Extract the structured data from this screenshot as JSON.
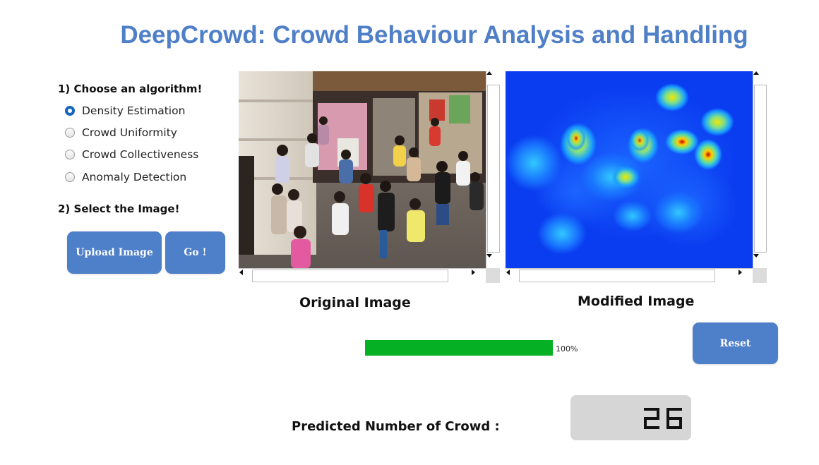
{
  "header": {
    "title": "DeepCrowd: Crowd Behaviour Analysis and Handling"
  },
  "algorithm": {
    "step_label": "1) Choose an algorithm!",
    "options": [
      {
        "label": "Density Estimation",
        "checked": true
      },
      {
        "label": "Crowd Uniformity",
        "checked": false
      },
      {
        "label": "Crowd Collectiveness",
        "checked": false
      },
      {
        "label": "Anomaly Detection",
        "checked": false
      }
    ]
  },
  "image_select": {
    "step_label": "2) Select the Image!",
    "upload_label": "Upload Image",
    "go_label": "Go !"
  },
  "viewers": {
    "original_caption": "Original Image",
    "modified_caption": "Modified Image"
  },
  "progress": {
    "percent_text": "100%",
    "value": 1.0
  },
  "reset_label": "Reset",
  "result": {
    "label": "Predicted Number of Crowd :",
    "value": "26"
  },
  "colors": {
    "title": "#4f7fc7",
    "button": "#4e7fc9",
    "progress": "#06b025",
    "radio_selected": "#1565c0",
    "heatmap_base": "#0a3cf0"
  },
  "icons": [
    "radio-button",
    "scroll-up-arrow-icon",
    "scroll-down-arrow-icon",
    "scroll-left-arrow-icon",
    "scroll-right-arrow-icon"
  ]
}
